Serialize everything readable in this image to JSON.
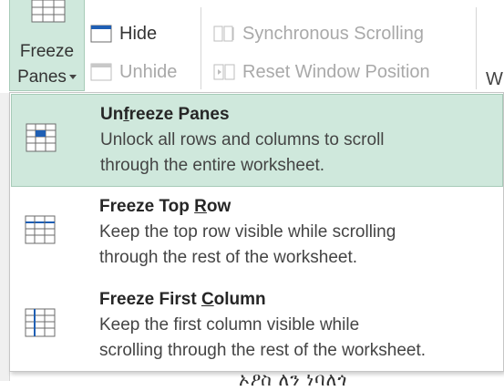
{
  "ribbon": {
    "freeze_panes": {
      "line1": "Freeze",
      "line2": "Panes"
    },
    "hide_label": "Hide",
    "unhide_label": "Unhide",
    "sync_scrolling_label": "Synchronous Scrolling",
    "reset_window_label": "Reset Window Position",
    "partial_label": "W"
  },
  "menu": {
    "items": [
      {
        "title_pre": "Un",
        "title_key": "f",
        "title_post": "reeze Panes",
        "desc_line1": "Unlock all rows and columns to scroll",
        "desc_line2": "through the entire worksheet."
      },
      {
        "title_pre": "Freeze Top ",
        "title_key": "R",
        "title_post": "ow",
        "desc_line1": "Keep the top row visible while scrolling",
        "desc_line2": "through the rest of the worksheet."
      },
      {
        "title_pre": "Freeze First ",
        "title_key": "C",
        "title_post": "olumn",
        "desc_line1": "Keep the first column visible while",
        "desc_line2": "scrolling through the rest of the worksheet."
      }
    ]
  },
  "background_fragment": "ኦዖስ ለን ነባለጎ",
  "colors": {
    "highlight": "#cfe8dc",
    "highlight_border": "#a7cbb8",
    "accent_blue": "#1f5fb4",
    "disabled_text": "#a9a9a9"
  }
}
